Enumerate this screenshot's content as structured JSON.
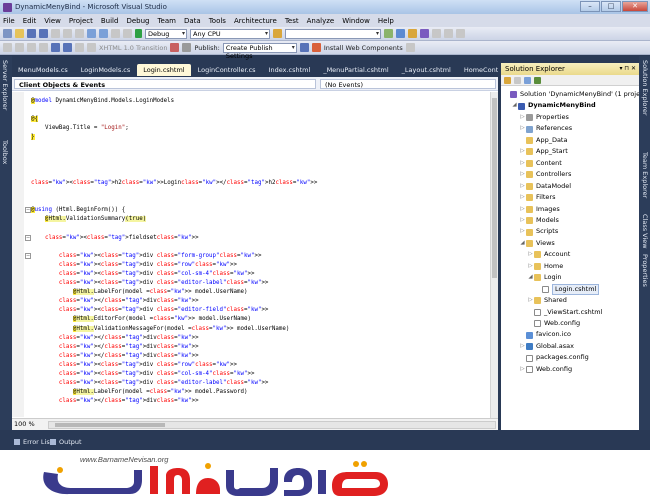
{
  "window": {
    "title": "DynamicMenyBind - Microsoft Visual Studio",
    "buttons": [
      "–",
      "□",
      "✕"
    ]
  },
  "menu": [
    "File",
    "Edit",
    "View",
    "Project",
    "Build",
    "Debug",
    "Team",
    "Data",
    "Tools",
    "Architecture",
    "Test",
    "Analyze",
    "Window",
    "Help"
  ],
  "toolbar": {
    "config": "Debug",
    "platform": "Any CPU",
    "doctype": "XHTML 1.0 Transition",
    "publish_label": "Publish:",
    "publish_profile": "Create Publish Settings",
    "install_label": "Install Web Components"
  },
  "side_tabs": {
    "left": [
      "Server Explorer",
      "Toolbox"
    ],
    "right": [
      "Solution Explorer",
      "Team Explorer",
      "Class View",
      "Properties"
    ]
  },
  "tabs": [
    "MenuModels.cs",
    "LoginModels.cs",
    "Login.cshtml",
    "LoginController.cs",
    "Index.cshtml",
    "_MenuPartial.cshtml",
    "_Layout.cshtml",
    "HomeController.cs"
  ],
  "active_tab": "Login.cshtml",
  "nav": {
    "left": "Client Objects & Events",
    "right": "(No Events)"
  },
  "code_lines": [
    "@model DynamicMenyBind.Models.LoginModels",
    "",
    "@{",
    "    ViewBag.Title = \"Login\";",
    "}",
    "",
    "",
    "",
    "",
    "<h2>Login</h2>",
    "",
    "",
    "@using (Html.BeginForm()) {",
    "    @Html.ValidationSummary(true)",
    "",
    "    <fieldset>",
    "",
    "        <div class=\"form-group\">",
    "        <div class=\"row\">",
    "        <div class=\"col-sm-4\">",
    "        <div class=\"editor-label\">",
    "            @Html.LabelFor(model => model.UserName)",
    "        </div>",
    "        <div class=\"editor-field\">",
    "            @Html.EditorFor(model => model.UserName)",
    "            @Html.ValidationMessageFor(model => model.UserName)",
    "        </div>",
    "        </div>",
    "        </div>",
    "        <div class=\"row\">",
    "        <div class=\"col-sm-4\">",
    "        <div class=\"editor-label\">",
    "            @Html.LabelFor(model => model.Password)",
    "        </div>"
  ],
  "zoom": "100 %",
  "solution_explorer": {
    "title": "Solution Explorer",
    "items": [
      {
        "label": "Solution 'DynamicMenyBind' (1 project)",
        "depth": 0,
        "icon": "solution-icon",
        "exp": ""
      },
      {
        "label": "DynamicMenyBind",
        "depth": 1,
        "icon": "project-icon",
        "exp": "◢",
        "bold": true
      },
      {
        "label": "Properties",
        "depth": 2,
        "icon": "properties-icon",
        "exp": "▷"
      },
      {
        "label": "References",
        "depth": 2,
        "icon": "references-icon",
        "exp": "▷"
      },
      {
        "label": "App_Data",
        "depth": 2,
        "icon": "folder-icon",
        "exp": ""
      },
      {
        "label": "App_Start",
        "depth": 2,
        "icon": "folder-icon",
        "exp": "▷"
      },
      {
        "label": "Content",
        "depth": 2,
        "icon": "folder-icon",
        "exp": "▷"
      },
      {
        "label": "Controllers",
        "depth": 2,
        "icon": "folder-icon",
        "exp": "▷"
      },
      {
        "label": "DataModel",
        "depth": 2,
        "icon": "folder-icon",
        "exp": "▷"
      },
      {
        "label": "Filters",
        "depth": 2,
        "icon": "folder-icon",
        "exp": "▷"
      },
      {
        "label": "Images",
        "depth": 2,
        "icon": "folder-icon",
        "exp": "▷"
      },
      {
        "label": "Models",
        "depth": 2,
        "icon": "folder-icon",
        "exp": "▷"
      },
      {
        "label": "Scripts",
        "depth": 2,
        "icon": "folder-icon",
        "exp": "▷"
      },
      {
        "label": "Views",
        "depth": 2,
        "icon": "folder-icon",
        "exp": "◢"
      },
      {
        "label": "Account",
        "depth": 3,
        "icon": "folder-icon",
        "exp": "▷"
      },
      {
        "label": "Home",
        "depth": 3,
        "icon": "folder-icon",
        "exp": "▷"
      },
      {
        "label": "Login",
        "depth": 3,
        "icon": "folder-icon",
        "exp": "◢"
      },
      {
        "label": "Login.cshtml",
        "depth": 4,
        "icon": "file-icon",
        "exp": "",
        "selected": true
      },
      {
        "label": "Shared",
        "depth": 3,
        "icon": "folder-icon",
        "exp": "▷"
      },
      {
        "label": "_ViewStart.cshtml",
        "depth": 3,
        "icon": "file-icon",
        "exp": ""
      },
      {
        "label": "Web.config",
        "depth": 3,
        "icon": "config-icon",
        "exp": ""
      },
      {
        "label": "favicon.ico",
        "depth": 2,
        "icon": "ico-icon",
        "exp": ""
      },
      {
        "label": "Global.asax",
        "depth": 2,
        "icon": "global-icon",
        "exp": "▷"
      },
      {
        "label": "packages.config",
        "depth": 2,
        "icon": "file-icon",
        "exp": ""
      },
      {
        "label": "Web.config",
        "depth": 2,
        "icon": "config-icon",
        "exp": "▷"
      }
    ]
  },
  "bottom_tabs": [
    "Error List",
    "Output"
  ],
  "logo": {
    "url": "www.BarnameNevisan.org",
    "text": "برنامه نویسان"
  }
}
